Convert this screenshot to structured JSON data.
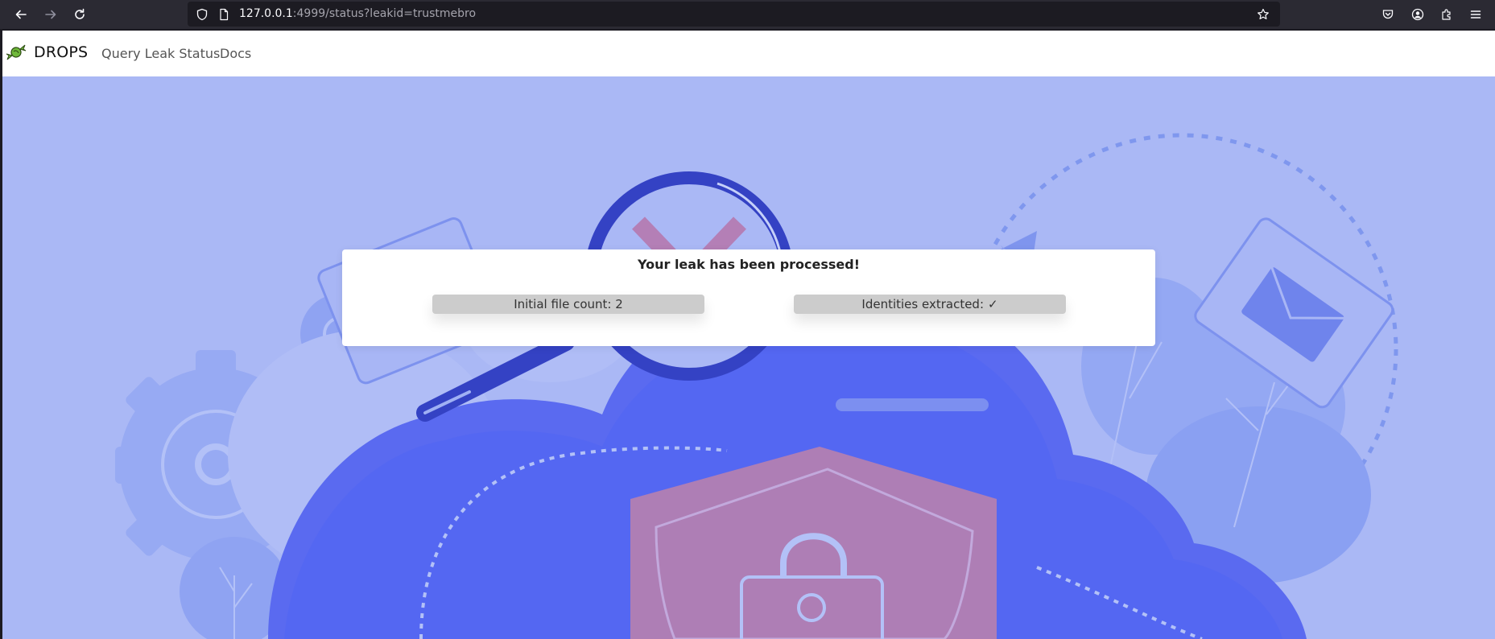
{
  "browser": {
    "url_host": "127.0.0.1",
    "url_rest": ":4999/status?leakid=trustmebro"
  },
  "navbar": {
    "brand": "DROPS",
    "links": [
      {
        "label": "Query Leak Status"
      },
      {
        "label": "Docs"
      }
    ]
  },
  "status_card": {
    "title": "Your leak has been processed!",
    "file_count_label": "Initial file count: 2",
    "identities_label": "Identities extracted:",
    "identities_mark": "✓"
  },
  "colors": {
    "page_background": "#aab8f5",
    "cloud": "#5a6af0",
    "shield": "#b07fb6",
    "magnifier": "#3442c4",
    "pill": "#cccccc"
  },
  "icons": [
    "back-arrow-icon",
    "forward-arrow-icon",
    "reload-icon",
    "shield-icon",
    "page-icon",
    "bookmark-star-icon",
    "pocket-icon",
    "account-icon",
    "extensions-icon",
    "menu-icon",
    "candy-logo-icon"
  ]
}
